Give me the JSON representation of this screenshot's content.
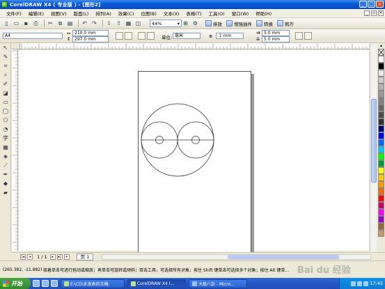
{
  "window": {
    "title": "CorelDRAW X4 ( 专业版 ) - [图形2]",
    "controls": [
      "_",
      "□",
      "×"
    ]
  },
  "menu": {
    "items": [
      "文件(F)",
      "编辑(E)",
      "视图(V)",
      "版面(L)",
      "排列(A)",
      "效果(C)",
      "位图(B)",
      "文本(X)",
      "表格(T)",
      "工具(O)",
      "窗口(W)",
      "帮助(H)"
    ]
  },
  "toolbar": {
    "zoom": "44%",
    "right_buttons": [
      "排放",
      "增强插件",
      "转换",
      "鸦齐"
    ]
  },
  "propbar": {
    "paper_preset": "A4",
    "width": "210.0 mm",
    "height": "297.0 mm",
    "units_label": "单位:",
    "units_value": "毫米",
    "nudge": ".1 mm",
    "dup_x": "5.0 mm",
    "dup_y": "5.0 mm"
  },
  "pagenav": {
    "counter": "1 / 1",
    "tab": "页 1"
  },
  "status": {
    "coords": "(265.382, -11.882)",
    "message": "接着单击可进行拖动或缩放；再单击可旋转或倾斜；双击工具，可选择所有对象；按住 Shift 键单击可选择多个对象；按住 Alt 键单...",
    "watermark": "Bai du 经验"
  },
  "taskbar": {
    "start": "开始",
    "tasks": [
      "E:\\CD\\未发表的文稿",
      "CorelDRAW X4 (...",
      "大极八卦 - Micro..."
    ],
    "clock": "17:45"
  },
  "palette_colors": [
    "#ffffff",
    "#000000",
    "#e8e8e8",
    "#cccccc",
    "#b3b3b3",
    "#999999",
    "#808080",
    "#666666",
    "#4d4d4d",
    "#333333",
    "#00007f",
    "#0000ff",
    "#0066ff",
    "#00ccff",
    "#00ff00",
    "#009933",
    "#ffff00",
    "#ffcc00",
    "#ff9900",
    "#ff6600",
    "#ff0000",
    "#cc0066",
    "#ff00ff",
    "#9900cc",
    "#996633",
    "#cc9966"
  ]
}
